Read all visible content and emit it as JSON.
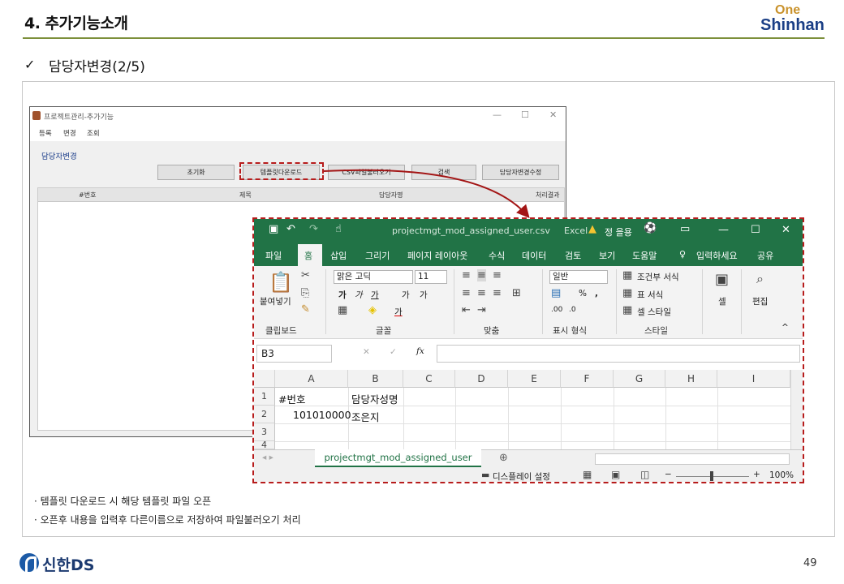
{
  "slide": {
    "title": "4. 추가기능소개",
    "logo_one": "One",
    "logo_shinhan": "Shinhan",
    "check": "✓",
    "subtitle": "담당자변경(2/5)",
    "page_number": "49",
    "footer_logo": "신한DS"
  },
  "notes": [
    "템플릿 다운로드 시 해당 템플릿 파일 오픈",
    "오픈후 내용을 입력후 다른이름으로 저장하여 파일불러오기 처리"
  ],
  "app": {
    "title": "프로젝트관리-추가기능",
    "window_controls": [
      "—",
      "☐",
      "✕"
    ],
    "menu": [
      "등록",
      "변경",
      "조회"
    ],
    "section": "담당자변경",
    "buttons": [
      "초기화",
      "템플릿다운로드",
      "CSV파일불러오기",
      "검색",
      "담당자변경수정"
    ],
    "grid_columns": [
      "#번호",
      "제목",
      "담당자명",
      "처리결과"
    ]
  },
  "excel": {
    "filename": "projectmgt_mod_assigned_user.csv",
    "app_name": "Excel",
    "user": "정 을용",
    "window_controls": [
      "—",
      "☐",
      "✕"
    ],
    "tabs": [
      "파일",
      "홈",
      "삽입",
      "그리기",
      "페이지 레이아웃",
      "수식",
      "데이터",
      "검토",
      "보기",
      "도움말",
      "입력하세요",
      "공유"
    ],
    "ribbon": {
      "paste": "붙여넣기",
      "font_name": "맑은 고딕",
      "font_size": "11",
      "number_format": "일반",
      "cond_format": "조건부 서식",
      "table_format": "표 서식",
      "cell_style": "셀 스타일",
      "cells": "셀",
      "editing": "편집",
      "groups": [
        "클립보드",
        "글꼴",
        "맞춤",
        "표시 형식",
        "스타일"
      ]
    },
    "name_box": "B3",
    "columns": [
      "A",
      "B",
      "C",
      "D",
      "E",
      "F",
      "G",
      "H",
      "I"
    ],
    "rows": [
      "1",
      "2",
      "3",
      "4"
    ],
    "cells": {
      "a1": "#번호",
      "b1": "담당자성명",
      "a2": "101010000",
      "b2": "조은지"
    },
    "sheet_tab": "projectmgt_mod_assigned_user",
    "status_display": "디스플레이 설정",
    "zoom": "100%"
  }
}
